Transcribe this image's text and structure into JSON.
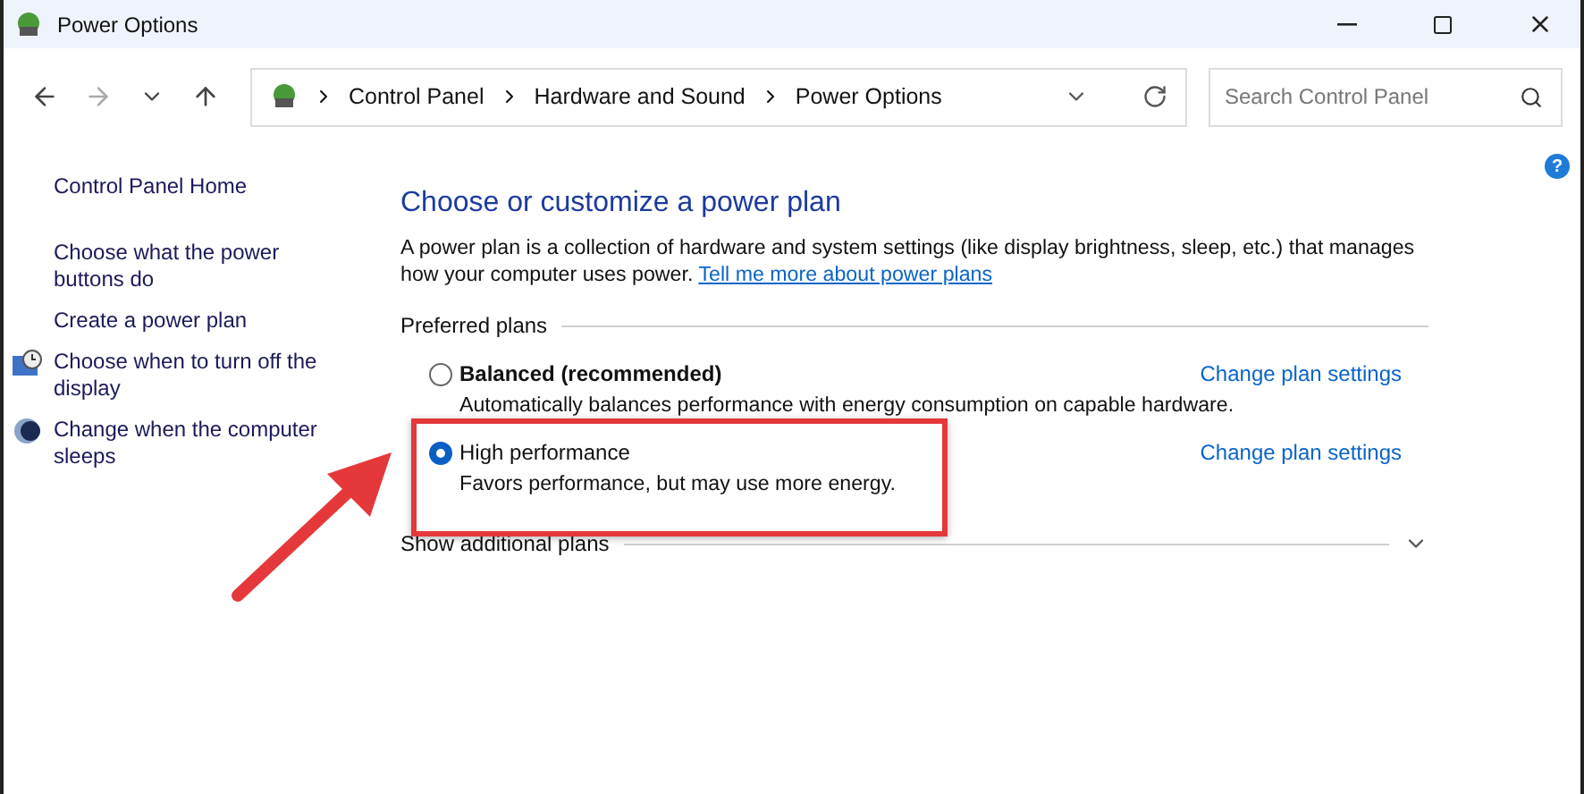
{
  "window": {
    "title": "Power Options"
  },
  "breadcrumb": [
    "Control Panel",
    "Hardware and Sound",
    "Power Options"
  ],
  "search": {
    "placeholder": "Search Control Panel"
  },
  "help": "?",
  "sidebar": {
    "home": "Control Panel Home",
    "items": [
      {
        "label": "Choose what the power buttons do",
        "kind": "link"
      },
      {
        "label": "Create a power plan",
        "kind": "link"
      },
      {
        "label": "Choose when to turn off the display",
        "kind": "display"
      },
      {
        "label": "Change when the computer sleeps",
        "kind": "sleep"
      }
    ]
  },
  "main": {
    "heading": "Choose or customize a power plan",
    "description": "A power plan is a collection of hardware and system settings (like display brightness, sleep, etc.) that manages how your computer uses power.",
    "link": "Tell me more about power plans",
    "section": "Preferred plans",
    "plans": [
      {
        "name": "Balanced (recommended)",
        "bold": true,
        "selected": false,
        "highlighted": false,
        "description": "Automatically balances performance with energy consumption on capable hardware.",
        "action": "Change plan settings"
      },
      {
        "name": "High performance",
        "bold": false,
        "selected": true,
        "highlighted": true,
        "description": "Favors performance, but may use more energy.",
        "action": "Change plan settings"
      }
    ],
    "more": "Show additional plans"
  }
}
